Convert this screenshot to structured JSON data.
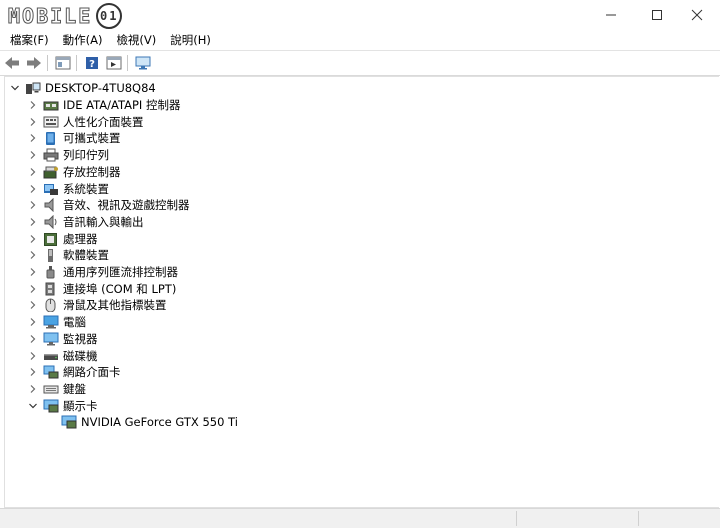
{
  "watermark": {
    "text": "MOBILE",
    "badge": "01",
    "small": ""
  },
  "window": {
    "controls": [
      "minimize-icon",
      "maximize-icon",
      "close-icon"
    ]
  },
  "menu": [
    {
      "label": "檔案(F)"
    },
    {
      "label": "動作(A)"
    },
    {
      "label": "檢視(V)"
    },
    {
      "label": "說明(H)"
    }
  ],
  "toolbar": {
    "icons": [
      "back-icon",
      "forward-icon",
      "properties-icon",
      "help-icon",
      "show-hide-icon",
      "monitor-scan-icon"
    ]
  },
  "tree": {
    "root": {
      "label": "DESKTOP-4TU8Q84",
      "icon": "computer-icon",
      "expanded": true
    },
    "categories": [
      {
        "label": "IDE ATA/ATAPI 控制器",
        "icon": "ide-controller-icon",
        "expanded": false
      },
      {
        "label": "人性化介面裝置",
        "icon": "hid-icon",
        "expanded": false
      },
      {
        "label": "可攜式裝置",
        "icon": "portable-device-icon",
        "expanded": false
      },
      {
        "label": "列印佇列",
        "icon": "printer-icon",
        "expanded": false
      },
      {
        "label": "存放控制器",
        "icon": "storage-controller-icon",
        "expanded": false
      },
      {
        "label": "系統裝置",
        "icon": "system-device-icon",
        "expanded": false
      },
      {
        "label": "音效、視訊及遊戲控制器",
        "icon": "speaker-icon",
        "expanded": false
      },
      {
        "label": "音訊輸入與輸出",
        "icon": "audio-io-icon",
        "expanded": false
      },
      {
        "label": "處理器",
        "icon": "processor-icon",
        "expanded": false
      },
      {
        "label": "軟體裝置",
        "icon": "software-device-icon",
        "expanded": false
      },
      {
        "label": "通用序列匯流排控制器",
        "icon": "usb-icon",
        "expanded": false
      },
      {
        "label": "連接埠 (COM 和 LPT)",
        "icon": "port-icon",
        "expanded": false
      },
      {
        "label": "滑鼠及其他指標裝置",
        "icon": "mouse-icon",
        "expanded": false
      },
      {
        "label": "電腦",
        "icon": "computer-monitor-icon",
        "expanded": false
      },
      {
        "label": "監視器",
        "icon": "monitor-icon",
        "expanded": false
      },
      {
        "label": "磁碟機",
        "icon": "disk-drive-icon",
        "expanded": false
      },
      {
        "label": "網路介面卡",
        "icon": "network-adapter-icon",
        "expanded": false
      },
      {
        "label": "鍵盤",
        "icon": "keyboard-icon",
        "expanded": false
      },
      {
        "label": "顯示卡",
        "icon": "display-adapter-icon",
        "expanded": true,
        "children": [
          {
            "label": "NVIDIA GeForce GTX 550 Ti",
            "icon": "display-adapter-icon"
          }
        ]
      }
    ]
  }
}
